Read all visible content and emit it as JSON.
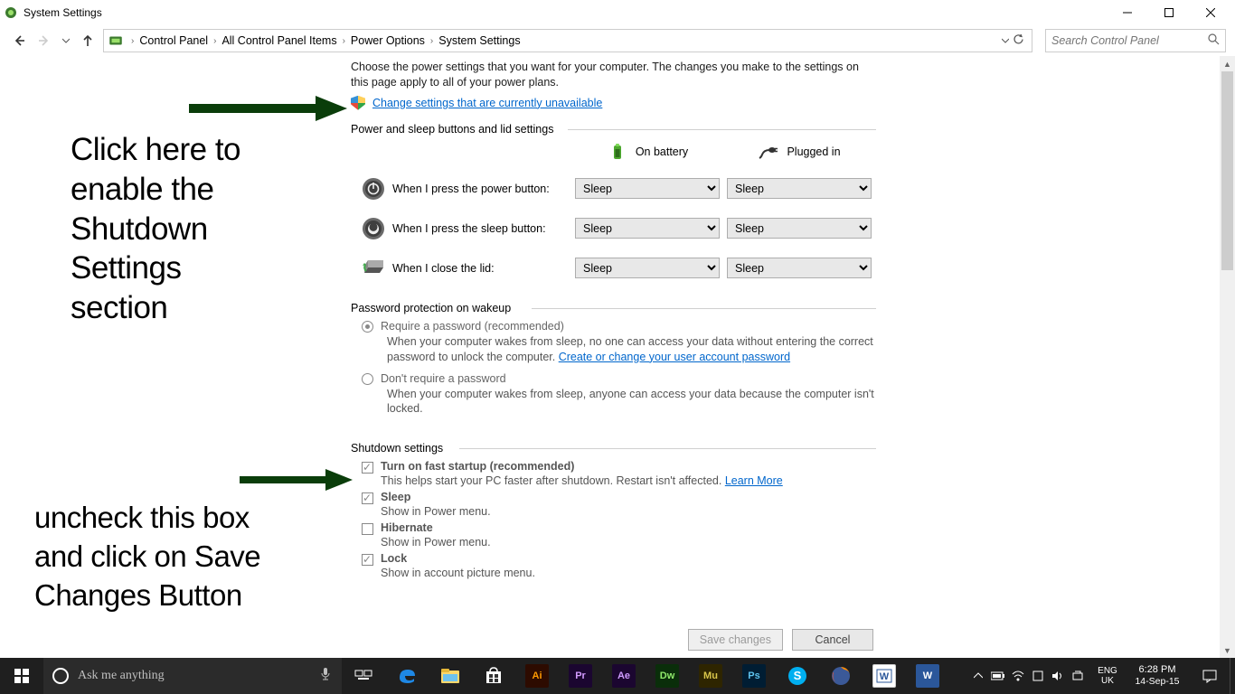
{
  "window": {
    "title": "System Settings"
  },
  "breadcrumb": {
    "items": [
      "Control Panel",
      "All Control Panel Items",
      "Power Options",
      "System Settings"
    ],
    "search_placeholder": "Search Control Panel"
  },
  "intro": "Choose the power settings that you want for your computer. The changes you make to the settings on this page apply to all of your power plans.",
  "change_link": "Change settings that are currently unavailable",
  "sections": {
    "power_buttons": "Power and sleep buttons and lid settings",
    "password": "Password protection on wakeup",
    "shutdown": "Shutdown settings"
  },
  "columns": {
    "battery": "On battery",
    "plugged": "Plugged in"
  },
  "rows": {
    "power": "When I press the power button:",
    "sleep": "When I press the sleep button:",
    "lid": "When I close the lid:"
  },
  "selects": {
    "power_battery": "Sleep",
    "power_plugged": "Sleep",
    "sleep_battery": "Sleep",
    "sleep_plugged": "Sleep",
    "lid_battery": "Sleep",
    "lid_plugged": "Sleep"
  },
  "password": {
    "require_label": "Require a password (recommended)",
    "require_desc": "When your computer wakes from sleep, no one can access your data without entering the correct password to unlock the computer. ",
    "require_link": "Create or change your user account password",
    "dont_label": "Don't require a password",
    "dont_desc": "When your computer wakes from sleep, anyone can access your data because the computer isn't locked."
  },
  "shutdown": {
    "fast_label": "Turn on fast startup (recommended)",
    "fast_desc": "This helps start your PC faster after shutdown. Restart isn't affected. ",
    "fast_link": "Learn More",
    "sleep_label": "Sleep",
    "sleep_desc": "Show in Power menu.",
    "hibernate_label": "Hibernate",
    "hibernate_desc": "Show in Power menu.",
    "lock_label": "Lock",
    "lock_desc": "Show in account picture menu."
  },
  "buttons": {
    "save": "Save changes",
    "cancel": "Cancel"
  },
  "annotations": {
    "a1": "Click here to\nenable the\nShutdown\nSettings\nsection",
    "a2": "uncheck this box\nand click on Save\nChanges Button"
  },
  "taskbar": {
    "cortana": "Ask me anything",
    "lang1": "ENG",
    "lang2": "UK",
    "time": "6:28 PM",
    "date": "14-Sep-15"
  }
}
